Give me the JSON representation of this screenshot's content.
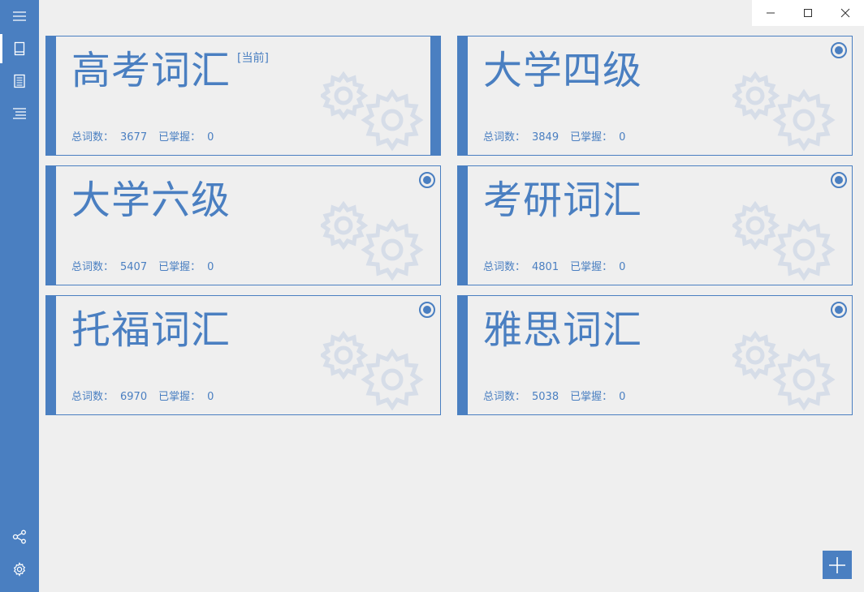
{
  "sidebar": {
    "items": [
      {
        "name": "menu",
        "icon": "hamburger-menu-icon"
      },
      {
        "name": "vocabulary-book",
        "icon": "book-icon",
        "active": true
      },
      {
        "name": "word-list",
        "icon": "document-icon"
      },
      {
        "name": "list",
        "icon": "list-icon"
      }
    ],
    "bottom_items": [
      {
        "name": "share",
        "icon": "share-icon"
      },
      {
        "name": "settings",
        "icon": "gear-icon"
      }
    ]
  },
  "colors": {
    "accent": "#4a7fc1",
    "background": "#efefef",
    "gear_watermark": "#d6dde8"
  },
  "labels": {
    "total_words": "总词数：",
    "mastered": "已掌握：",
    "current_tag": "[当前]"
  },
  "books": [
    {
      "title": "高考词汇",
      "total": "3677",
      "mastered": "0",
      "current": true
    },
    {
      "title": "大学四级",
      "total": "3849",
      "mastered": "0",
      "current": false
    },
    {
      "title": "大学六级",
      "total": "5407",
      "mastered": "0",
      "current": false
    },
    {
      "title": "考研词汇",
      "total": "4801",
      "mastered": "0",
      "current": false
    },
    {
      "title": "托福词汇",
      "total": "6970",
      "mastered": "0",
      "current": false
    },
    {
      "title": "雅思词汇",
      "total": "5038",
      "mastered": "0",
      "current": false
    }
  ],
  "fab": {
    "icon": "plus-icon"
  },
  "window_controls": [
    "minimize-icon",
    "maximize-icon",
    "close-icon"
  ]
}
